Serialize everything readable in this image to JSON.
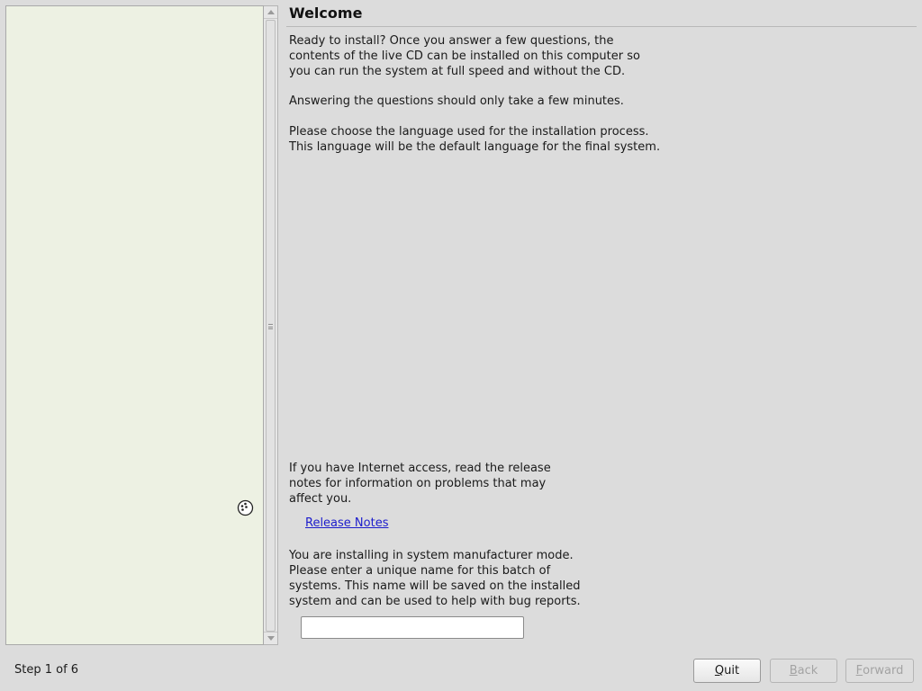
{
  "header": {
    "title": "Welcome"
  },
  "content": {
    "intro": "Ready to install? Once you answer a few questions, the\ncontents of the live CD can be installed on this computer so\nyou can run the system at full speed and without the CD.",
    "time_note": "Answering the questions should only take a few minutes.",
    "language_prompt": "Please choose the language used for the installation process.\nThis language will be the default language for the final system.",
    "internet_note": "If you have Internet access, read the release\nnotes for information on problems that may\naffect you.",
    "release_notes_link": "Release Notes",
    "oem_note": "You are installing in system manufacturer mode.\nPlease enter a unique name for this batch of\nsystems. This name will be saved on the installed\nsystem and can be used to help with bug reports.",
    "batch_name_value": ""
  },
  "footer": {
    "step_label": "Step 1 of 6",
    "quit": {
      "mnemonic": "Q",
      "rest": "uit"
    },
    "back": {
      "mnemonic": "B",
      "rest": "ack"
    },
    "forward": {
      "mnemonic": "F",
      "rest": "orward"
    }
  },
  "icons": {
    "busy": "busy-cursor-icon",
    "scroll_up": "arrow-up-icon",
    "scroll_down": "arrow-down-icon",
    "scroll_grip": "grip-icon"
  },
  "colors": {
    "list_background": "#edf1e3",
    "window_background": "#dcdcdc",
    "link": "#1c1ccc"
  }
}
